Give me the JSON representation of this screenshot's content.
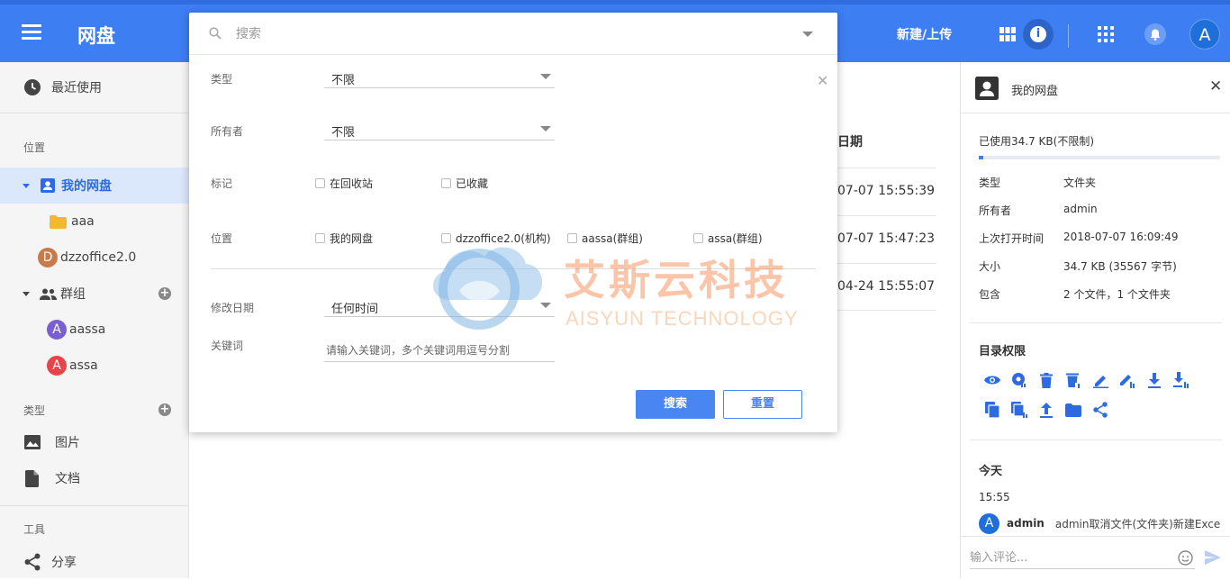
{
  "topbar": {
    "app_title": "网盘",
    "upload_label": "新建/上传",
    "avatar_letter": "A"
  },
  "sidebar": {
    "recent_label": "最近使用",
    "location_section": "位置",
    "my_disk_label": "我的网盘",
    "folder_aaa": "aaa",
    "org_letter": "D",
    "org_label": "dzzoffice2.0",
    "groups_label": "群组",
    "group1_letter": "A",
    "group1_label": "aassa",
    "group2_letter": "A",
    "group2_label": "assa",
    "type_section": "类型",
    "images_label": "图片",
    "docs_label": "文档",
    "tools_section": "工具",
    "share_label": "分享"
  },
  "main": {
    "date_header": "日期",
    "rows": [
      "07-07 15:55:39",
      "07-07 15:47:23",
      "04-24 15:55:07"
    ]
  },
  "search": {
    "placeholder": "搜索",
    "type_label": "类型",
    "type_value": "不限",
    "owner_label": "所有者",
    "owner_value": "不限",
    "mark_label": "标记",
    "mark_options": [
      "在回收站",
      "已收藏"
    ],
    "location_label": "位置",
    "location_options": [
      "我的网盘",
      "dzzoffice2.0(机构)",
      "aassa(群组)",
      "assa(群组)"
    ],
    "modified_label": "修改日期",
    "modified_value": "任何时间",
    "keyword_label": "关键词",
    "keyword_placeholder": "请输入关键词，多个关键词用逗号分割",
    "search_button": "搜索",
    "reset_button": "重置"
  },
  "watermark": {
    "cn": "艾斯云科技",
    "en": "AISYUN TECHNOLOGY"
  },
  "right_panel": {
    "title": "我的网盘",
    "usage": "已使用34.7 KB(不限制)",
    "usage_fraction": 0.02,
    "props": [
      {
        "k": "类型",
        "v": "文件夹"
      },
      {
        "k": "所有者",
        "v": "admin"
      },
      {
        "k": "上次打开时间",
        "v": "2018-07-07 16:09:49"
      },
      {
        "k": "大小",
        "v": "34.7 KB (35567 字节)"
      },
      {
        "k": "包含",
        "v": "2 个文件，1 个文件夹"
      }
    ],
    "perm_title": "目录权限",
    "activity_title": "今天",
    "activity_time": "15:55",
    "activity_avatar": "A",
    "activity_user": "admin",
    "activity_text": "admin取消文件(文件夹)新建Exce",
    "comment_placeholder": "输入评论..."
  },
  "colors": {
    "primary": "#3d7ef3",
    "accent_blue": "#4a86f1",
    "org_avatar": "#c87a4a",
    "group1_avatar": "#7a5fd0",
    "group2_avatar": "#e8434a"
  }
}
